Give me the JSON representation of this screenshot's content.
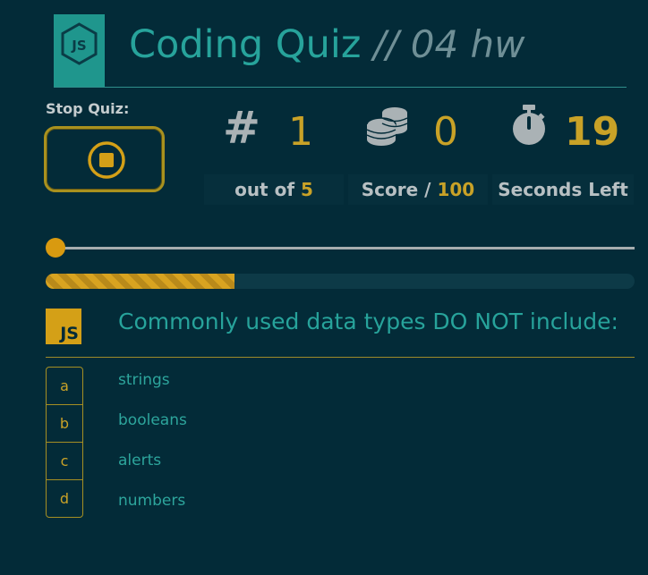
{
  "header": {
    "title": "Coding Quiz",
    "subtitle": "// 04 hw",
    "logo_icon": "nodejs-logo-icon"
  },
  "stop": {
    "label": "Stop Quiz:",
    "icon": "stop-circle-icon"
  },
  "stats": {
    "question_icon": "#",
    "question_number": "1",
    "score_icon": "coins-stack-icon",
    "score": "0",
    "timer_icon": "stopwatch-icon",
    "seconds_left": "19",
    "out_of_label": "out of",
    "out_of_value": "5",
    "score_label": "Score /",
    "score_max": "100",
    "seconds_label": "Seconds Left"
  },
  "slider": {
    "value_fraction": 0
  },
  "progress": {
    "value_percent": 32
  },
  "question": {
    "badge": "JS",
    "text": "Commonly used data types DO NOT include:"
  },
  "choices": [
    {
      "letter": "a",
      "text": "strings"
    },
    {
      "letter": "b",
      "text": "booleans"
    },
    {
      "letter": "c",
      "text": "alerts"
    },
    {
      "letter": "d",
      "text": "numbers"
    }
  ],
  "colors": {
    "background": "#032b38",
    "teal": "#27a39b",
    "gold": "#c9a227"
  }
}
